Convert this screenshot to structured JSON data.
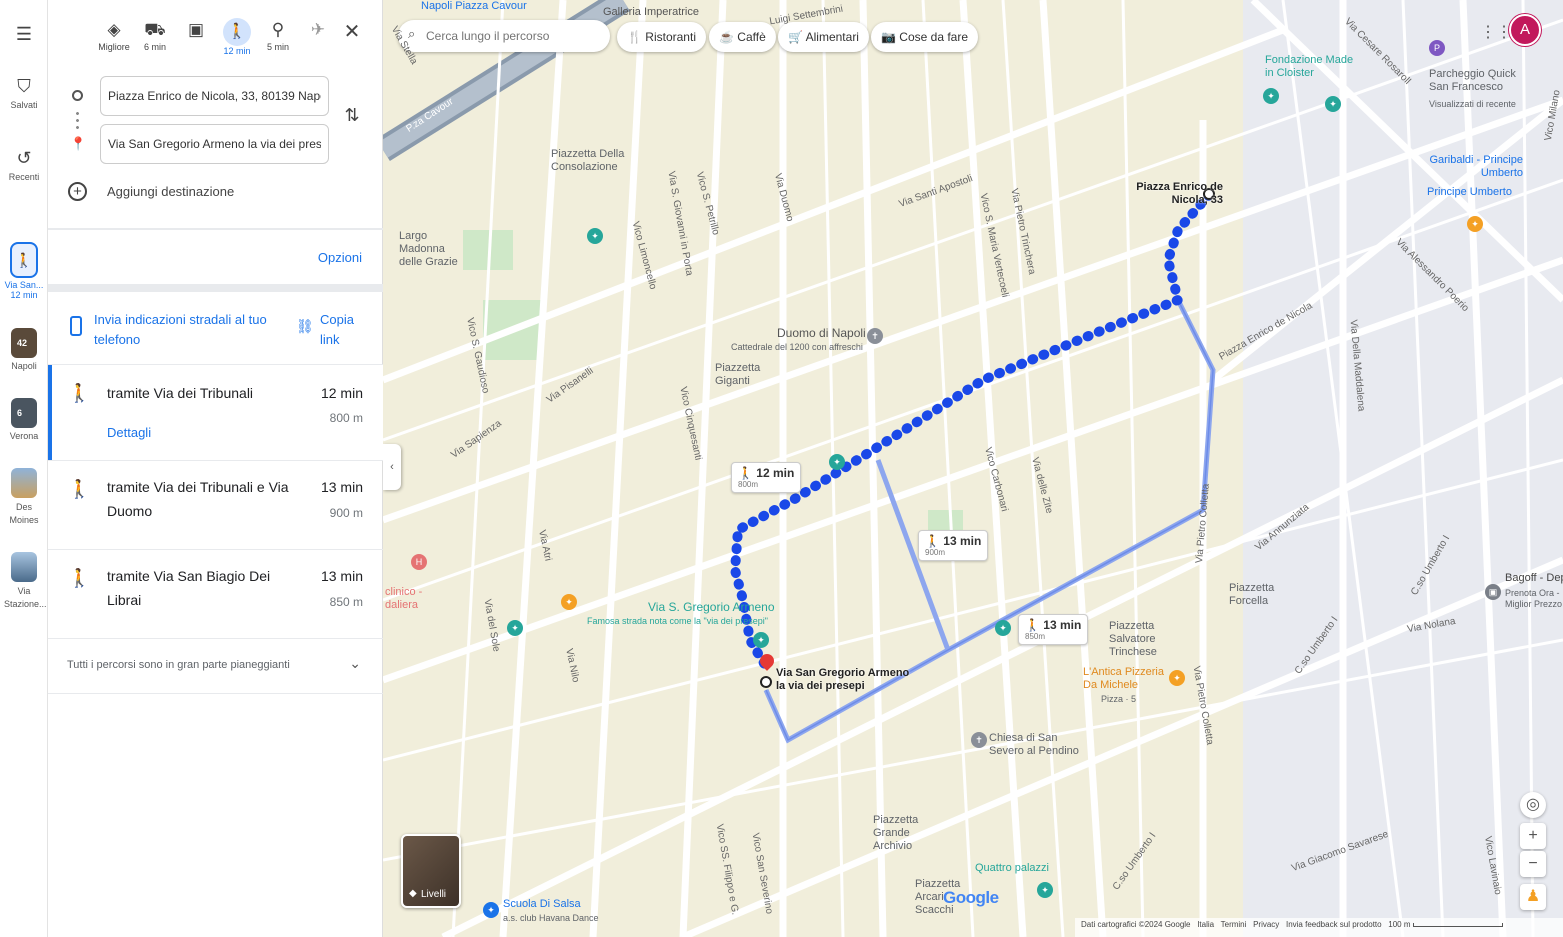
{
  "rail": {
    "saved": "Salvati",
    "recent": "Recenti",
    "trip_label": "Via San...",
    "trip_time": "12 min",
    "places": [
      {
        "label": "Napoli",
        "badge": "42",
        "color": "#5a4a3a"
      },
      {
        "label": "Verona",
        "badge": "6",
        "color": "#4a5560"
      },
      {
        "label": "Des Moines",
        "badge": "",
        "color": "#b89060"
      },
      {
        "label": "Via Stazione...",
        "badge": "",
        "color": "#5a7a9a"
      }
    ]
  },
  "modes": [
    {
      "name": "best",
      "label": "Migliore",
      "icon": "◈"
    },
    {
      "name": "car",
      "label": "6 min",
      "icon": "🚘"
    },
    {
      "name": "transit",
      "label": "",
      "icon": "🚌"
    },
    {
      "name": "walk",
      "label": "12 min",
      "icon": "🚶"
    },
    {
      "name": "bike",
      "label": "5 min",
      "icon": "🚲"
    },
    {
      "name": "flight",
      "label": "",
      "icon": "✈"
    }
  ],
  "directions": {
    "origin": "Piazza Enrico de Nicola, 33, 80139 Napoli",
    "destination": "Via San Gregorio Armeno la via dei presepi",
    "add_destination": "Aggiungi destinazione",
    "options": "Opzioni",
    "send_to_phone": "Invia indicazioni stradali al tuo telefono",
    "copy_link": "Copia link",
    "routes": [
      {
        "title": "tramite Via dei Tribunali",
        "time": "12 min",
        "dist": "800 m",
        "details": "Dettagli"
      },
      {
        "title": "tramite Via dei Tribunali e Via Duomo",
        "time": "13 min",
        "dist": "900 m",
        "details": ""
      },
      {
        "title": "tramite Via San Biagio Dei Librai",
        "time": "13 min",
        "dist": "850 m",
        "details": ""
      }
    ],
    "footer": "Tutti i percorsi sono in gran parte pianeggianti"
  },
  "map": {
    "search_placeholder": "Cerca lungo il percorso",
    "chips": [
      "Ristoranti",
      "Caffè",
      "Alimentari",
      "Cose da fare"
    ],
    "avatar": "A",
    "route_badges": [
      {
        "time": "12 min",
        "dist": "800m"
      },
      {
        "time": "13 min",
        "dist": "900m"
      },
      {
        "time": "13 min",
        "dist": "850m"
      }
    ],
    "origin_label": "Piazza Enrico de Nicola, 33",
    "dest_label": "Via San Gregorio Armeno la via dei presepi",
    "labels": {
      "napoli_cavour": "Napoli Piazza Cavour",
      "galleria": "Galleria Imperatrice",
      "piazzetta_consolazione": "Piazzetta Della Consolazione",
      "largo_madonna": "Largo Madonna delle Grazie",
      "duomo": "Duomo di Napoli",
      "duomo_sub": "Cattedrale del 1200 con affreschi",
      "piazzetta_giganti": "Piazzetta Giganti",
      "fondazione": "Fondazione Made in Cloister",
      "parcheggio": "Parcheggio Quick San Francesco",
      "parcheggio_sub": "Visualizzati di recente",
      "garibaldi": "Garibaldi - Principe Umberto",
      "principe_umberto": "Principe Umberto",
      "via_sgregorio": "Via S. Gregorio Armeno",
      "via_sgregorio_sub": "Famosa strada nota come la \"via dei presepi\"",
      "clinico": "clinico - daliera",
      "piazzetta_salvatore": "Piazzetta Salvatore Trinchese",
      "antica_pizzeria": "L'Antica Pizzeria Da Michele",
      "antica_sub": "Pizza · 5",
      "piazzetta_forcella": "Piazzetta Forcella",
      "chiesa": "Chiesa di San Severo al Pendino",
      "piazzetta_grande": "Piazzetta Grande Archivio",
      "quattro_palazzi": "Quattro palazzi",
      "piazzetta_arcari": "Piazzetta Arcari Scacchi",
      "scuola_salsa": "Scuola Di Salsa",
      "scuola_sub": "a.s. club Havana Dance",
      "bagoff": "Bagoff - Deposito B...",
      "bagoff_sub": "Prenota Ora - Miglior Prezzo",
      "livelli": "Livelli",
      "google": "Google"
    },
    "streets": {
      "via_stella": "Via Stella",
      "pza_cavour": "P.za Cavour",
      "via_settembrini": "Luigi Settembrini",
      "via_cesare": "Via Cesare Rosaroll",
      "via_santi_apostoli": "Via Santi Apostoli",
      "via_duomo": "Via Duomo",
      "vico_petrillo": "Vico S. Petrillo",
      "via_giovanni": "Via S. Giovanni in Porta",
      "vico_limoncello": "Vico Limoncello",
      "vico_maria": "Vico S. Maria Vertecoeli",
      "via_trinchera": "Via Pietro Trinchera",
      "via_pisanelli": "Via Pisanelli",
      "via_sapienza": "Via Sapienza",
      "vico_gaudioso": "Vico S. Gaudioso",
      "vico_cinquesanti": "Vico Cinquesanti",
      "via_atri": "Via Atri",
      "via_sole": "Via del Sole",
      "via_nilo": "Via Nilo",
      "vico_carbonari": "Vico Carbonari",
      "via_zite": "Via delle Zite",
      "via_colletta": "Via Pietro Colletta",
      "via_annunziata": "Via Annunziata",
      "piazza_enrico": "Piazza Enrico de Nicola",
      "via_alessandro": "Via Alessandro Poerio",
      "via_maddalena": "Via Della Maddalena",
      "corso_umberto": "C.so Umberto I",
      "via_savarese": "Via Giacomo Savarese",
      "vico_milano": "Vico Milano",
      "vico_lavinaio": "Vico Lavinaio",
      "vico_paladino": "Vico SS. Filippo e G.",
      "via_severino": "Vico San Severino",
      "vico_nolana": "Via Nolana"
    },
    "footer": [
      "Dati cartografici ©2024 Google",
      "Italia",
      "Termini",
      "Privacy",
      "Invia feedback sul prodotto",
      "100 m"
    ],
    "colors": {
      "route_primary": "#1a48e8",
      "route_alt": "#8da6ee",
      "accent": "#1a73e8",
      "map_bg": "#f1eedb",
      "street": "#ffffff",
      "park": "#cfe8c8",
      "pin_teal": "#26a69a",
      "pin_orange": "#f4a024",
      "dest_red": "#e53935",
      "avatar_bg": "#c2185b"
    }
  }
}
